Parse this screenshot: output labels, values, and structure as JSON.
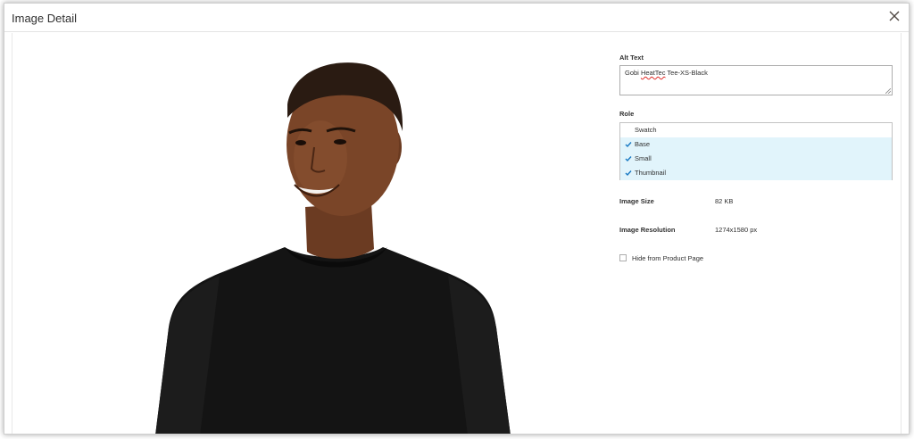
{
  "modal": {
    "title": "Image Detail",
    "close_icon": "close-icon"
  },
  "image": {
    "description_icon": "product-photo"
  },
  "details": {
    "alt_text": {
      "label": "Alt Text",
      "value_before": "Gobi ",
      "value_spell": "HeatTec",
      "value_after": " Tee-XS-Black"
    },
    "role": {
      "label": "Role",
      "options": [
        {
          "label": "Swatch",
          "selected": false
        },
        {
          "label": "Base",
          "selected": true
        },
        {
          "label": "Small",
          "selected": true
        },
        {
          "label": "Thumbnail",
          "selected": true
        }
      ]
    },
    "image_size": {
      "label": "Image Size",
      "value": "82 KB"
    },
    "image_resolution": {
      "label": "Image Resolution",
      "value": "1274x1580 px"
    },
    "hide_from_product_page": {
      "label": "Hide from Product Page",
      "checked": false
    }
  },
  "colors": {
    "selected_bg": "#e1f4fb",
    "check": "#1979c3",
    "border": "#adadad"
  }
}
